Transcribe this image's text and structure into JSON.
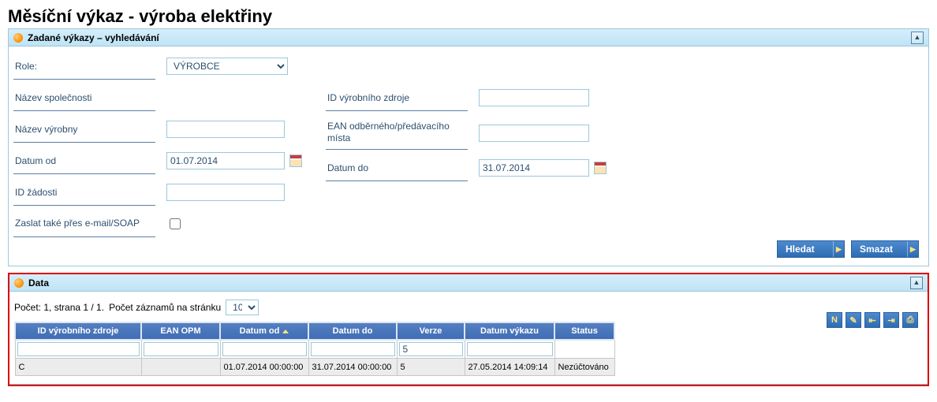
{
  "page_title": "Měsíční výkaz - výroba elektřiny",
  "search_panel": {
    "title": "Zadané výkazy – vyhledávání",
    "labels": {
      "role": "Role:",
      "company": "Název společnosti",
      "plant": "Název výrobny",
      "date_from": "Datum od",
      "request_id": "ID žádosti",
      "send_soap": "Zaslat také přes e-mail/SOAP",
      "source_id": "ID výrobního zdroje",
      "ean": "EAN odběrného/předávacího místa",
      "date_to": "Datum do"
    },
    "values": {
      "role": "VÝROBCE",
      "company": "",
      "plant": "",
      "date_from": "01.07.2014",
      "request_id": "",
      "send_soap": false,
      "source_id": "",
      "ean": "",
      "date_to": "31.07.2014"
    },
    "role_options": [
      "VÝROBCE"
    ],
    "buttons": {
      "search": "Hledat",
      "clear": "Smazat"
    }
  },
  "data_panel": {
    "title": "Data",
    "pager": {
      "summary_prefix": "Počet: 1, strana 1 / 1.",
      "per_page_label": "Počet záznamů na stránku",
      "per_page_value": "10"
    },
    "columns": [
      "ID výrobního zdroje",
      "EAN OPM",
      "Datum od",
      "Datum do",
      "Verze",
      "Datum výkazu",
      "Status"
    ],
    "sort_col_index": 2,
    "filter_values": [
      "",
      "",
      "",
      "",
      "5",
      "",
      ""
    ],
    "rows": [
      {
        "c": [
          "C",
          "",
          "01.07.2014 00:00:00",
          "31.07.2014 00:00:00",
          "5",
          "27.05.2014 14:09:14",
          "Nezúčtováno"
        ]
      }
    ],
    "toolbar_icons": [
      "new-icon",
      "edit-icon",
      "export-icon",
      "import-icon",
      "print-icon"
    ]
  }
}
